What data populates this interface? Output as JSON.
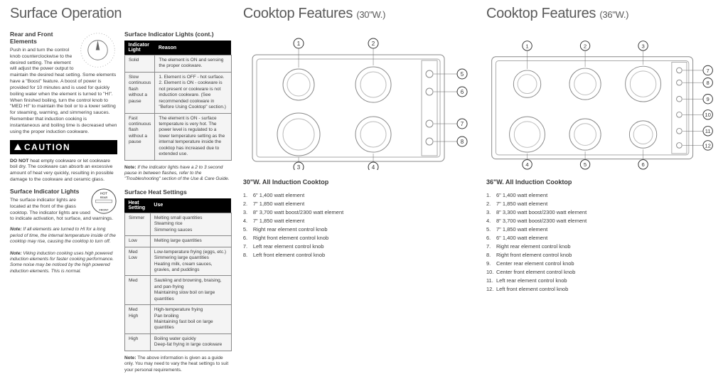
{
  "surface": {
    "title": "Surface Operation",
    "elements_h": "Rear and Front Elements",
    "elements_p": "Push in and turn the control knob counterclockwise to the desired setting. The element will adjust the power output to maintain the desired heat setting. Some elements have a \"Boost\" feature. A boost of power is provided for 10 minutes and is used for quickly boiling water when the element is turned to \"HI\". When finished boiling, turn the control knob to \"MED HI\" to maintain the boil or to a lower setting for steaming, warming, and simmering sauces. Remember that induction cooking is instantaneous and boiling time is decreased when using the proper induction cookware.",
    "caution": "CAUTION",
    "caution_body": "DO NOT heat empty cookware or let cookware boil dry. The cookware can absorb an excessive amount of heat very quickly, resulting in possible damage to the cookware and ceramic glass.",
    "sil_h": "Surface Indicator Lights",
    "sil_p": "The surface indicator lights are located at the front of the glass cooktop. The indicator lights are used to indicate activation, hot surface, and warnings.",
    "note1": "If all elements are turned to HI for a long period of time, the internal temperature inside of the cooktop may rise, causing the cooktop to turn off.",
    "note2": "Viking induction cooking uses high powered induction elements for faster cooking performance. Some noise may be noticed by the high powered induction elements. This is normal.",
    "silc_h": "Surface Indicator Lights (cont.)",
    "tab1": {
      "h1": "Indicator Light",
      "h2": "Reason",
      "rows": [
        [
          "Solid",
          "The element is ON and sensing the proper cookware."
        ],
        [
          "Slow continuous flash without a pause",
          "1. Element is OFF - hot surface.\n2. Element is ON - cookware is not present or cookware is not induction cookware. (See recommended cookware in \"Before Using Cooktop\" section.)"
        ],
        [
          "Fast continuous flash without a pause",
          "The element is ON - surface temperature is very hot. The power level is regulated to a lower temperature setting as the internal temperature inside the cooktop has increased due to extended use."
        ]
      ]
    },
    "tab1_note": "If the indicator lights have a 2 to 3 second pause in between flashes, refer to the \"Troubleshooting\" section of the Use & Care Guide.",
    "shs_h": "Surface Heat Settings",
    "tab2": {
      "h1": "Heat Setting",
      "h2": "Use",
      "rows": [
        [
          "Simmer",
          "Melting small quantities\nSteaming rice\nSimmering sauces"
        ],
        [
          "Low",
          "Melting large quantities"
        ],
        [
          "Med Low",
          "Low-temperature frying (eggs, etc.)\nSimmering large quantities\nHeating milk, cream sauces, gravies, and puddings"
        ],
        [
          "Med",
          "Sautéing and browning, braising, and pan-frying\nMaintaining slow boil on large quantities"
        ],
        [
          "Med High",
          "High-temperature frying\nPan broiling\nMaintaining fast boil on large quantities"
        ],
        [
          "High",
          "Boiling water quickly\nDeep-fat frying in large cookware"
        ]
      ]
    },
    "tab2_note": "The above information is given as a guide only. You may need to vary the heat settings to suit your personal requirements."
  },
  "c30": {
    "title": "Cooktop Features",
    "sub": "(30\"W.)",
    "list_h": "30\"W. All Induction Cooktop",
    "items": [
      "6\" 1,400 watt element",
      "7\" 1,850 watt element",
      "8\" 3,700 watt boost/2300 watt element",
      "7\" 1,850 watt element",
      "Right rear element control knob",
      "Right front element control knob",
      "Left rear element control knob",
      "Left front element control knob"
    ]
  },
  "c36": {
    "title": "Cooktop Features",
    "sub": "(36\"W.)",
    "list_h": "36\"W. All Induction Cooktop",
    "items": [
      "6\" 1,400 watt element",
      "7\" 1,850 watt element",
      "8\" 3,300 watt boost/2300 watt element",
      "8\" 3,700 watt boost/2300 watt element",
      "7\" 1,850 watt element",
      "6\" 1,400 watt element",
      "Right rear element control knob",
      "Right front element control knob",
      "Center rear element control knob",
      "Center front element control knob",
      "Left rear element control knob",
      "Left front element control knob"
    ]
  },
  "labels": {
    "note": "Note:",
    "donot": "DO NOT"
  }
}
